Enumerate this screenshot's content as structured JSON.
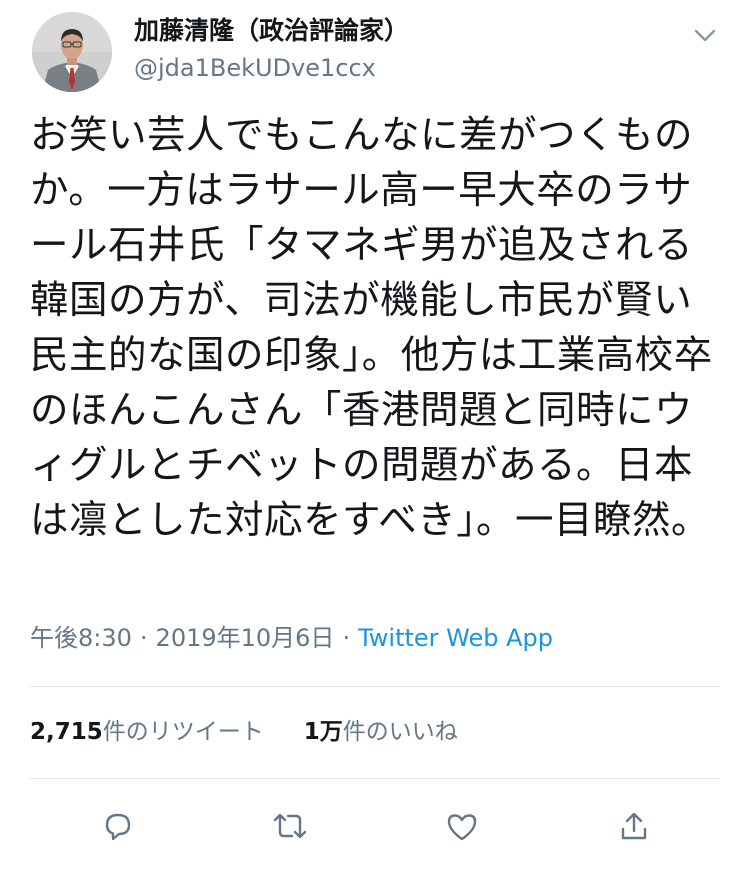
{
  "author": {
    "display_name": "加藤清隆（政治評論家）",
    "handle": "@jda1BekUDve1ccx"
  },
  "tweet": {
    "text": "お笑い芸人でもこんなに差がつくものか。一方はラサール高ー早大卒のラサール石井氏「タマネギ男が追及される韓国の方が、司法が機能し市民が賢い民主的な国の印象」。他方は工業高校卒のほんこんさん「香港問題と同時にウィグルとチベットの問題がある。日本は凛とした対応をすべき」。一目瞭然。",
    "time": "午後8:30",
    "date": "2019年10月6日",
    "separator": "·",
    "source": "Twitter Web App"
  },
  "stats": {
    "retweets_count": "2,715",
    "retweets_label": "件のリツイート",
    "likes_count": "1万",
    "likes_label": "件のいいね"
  },
  "icons": {
    "more": "chevron-down-icon",
    "reply": "reply-icon",
    "retweet": "retweet-icon",
    "like": "heart-icon",
    "share": "share-icon"
  },
  "colors": {
    "text": "#14171a",
    "muted": "#657786",
    "link": "#1b95e0",
    "divider": "#e1e8ed"
  }
}
